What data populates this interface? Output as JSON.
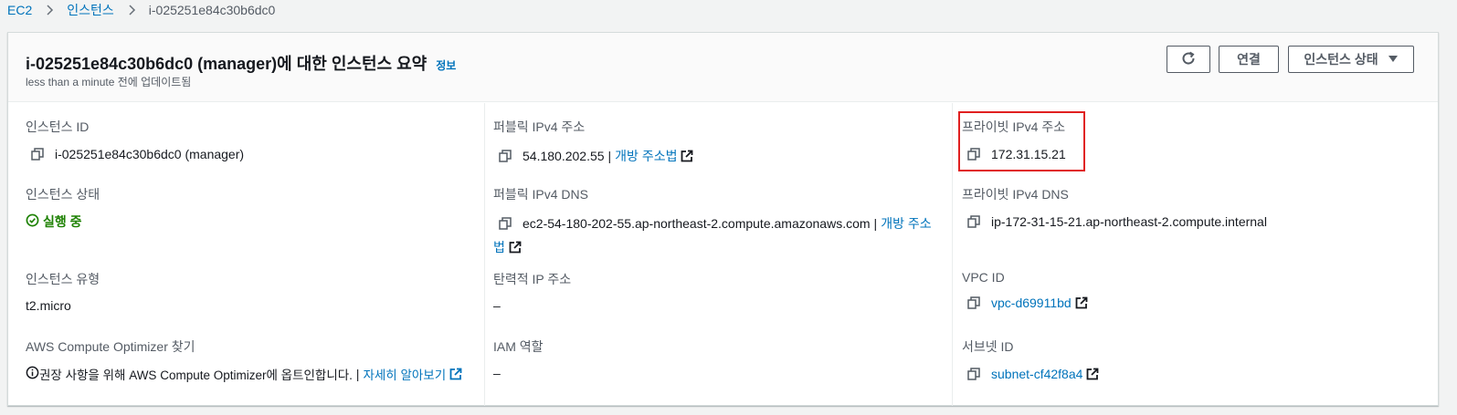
{
  "breadcrumb": {
    "items": [
      "EC2",
      "인스턴스"
    ],
    "current": "i-025251e84c30b6dc0"
  },
  "header": {
    "title": "i-025251e84c30b6dc0 (manager)에 대한 인스턴스 요약",
    "info": "정보",
    "subtitle": "less than a minute 전에 업데이트됨",
    "connect_label": "연결",
    "state_label": "인스턴스 상태"
  },
  "fields": {
    "instance_id": {
      "label": "인스턴스 ID",
      "value": "i-025251e84c30b6dc0 (manager)"
    },
    "public_ipv4": {
      "label": "퍼블릭 IPv4 주소",
      "value": "54.180.202.55",
      "sep": "|",
      "link": "개방 주소법"
    },
    "private_ipv4": {
      "label": "프라이빗 IPv4 주소",
      "value": "172.31.15.21"
    },
    "instance_state": {
      "label": "인스턴스 상태",
      "value": "실행 중"
    },
    "public_dns": {
      "label": "퍼블릭 IPv4 DNS",
      "value": "ec2-54-180-202-55.ap-northeast-2.compute.amazonaws.com",
      "sep": "|",
      "link_part1": "개방 주소",
      "link_part2": "법"
    },
    "private_dns": {
      "label": "프라이빗 IPv4 DNS",
      "value": "ip-172-31-15-21.ap-northeast-2.compute.internal"
    },
    "instance_type": {
      "label": "인스턴스 유형",
      "value": "t2.micro"
    },
    "elastic_ip": {
      "label": "탄력적 IP 주소",
      "value": "–"
    },
    "vpc_id": {
      "label": "VPC ID",
      "value": "vpc-d69911bd"
    },
    "optimizer": {
      "label": "AWS Compute Optimizer 찾기",
      "value": "권장 사항을 위해 AWS Compute Optimizer에 옵트인합니다.",
      "sep": "|",
      "link": "자세히 알아보기"
    },
    "iam_role": {
      "label": "IAM 역할",
      "value": "–"
    },
    "subnet_id": {
      "label": "서브넷 ID",
      "value": "subnet-cf42f8a4"
    }
  },
  "colors": {
    "link": "#0073bb",
    "running": "#1d8102",
    "highlight": "#e02020"
  },
  "icons": [
    "chevron-right-icon",
    "refresh-icon",
    "caret-down-icon",
    "copy-icon",
    "external-link-icon",
    "check-circle-icon",
    "info-circle-icon"
  ]
}
